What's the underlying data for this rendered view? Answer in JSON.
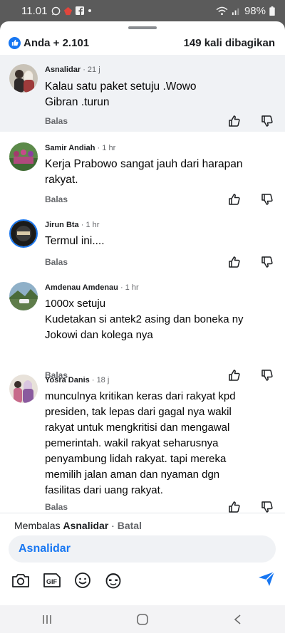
{
  "status_bar": {
    "time": "11.01",
    "battery": "98%"
  },
  "reactions": {
    "summary": "Anda + 2.101",
    "shares": "149 kali dibagikan"
  },
  "comments": [
    {
      "name": "Asnalidar",
      "time": "21 j",
      "text_lines": [
        "Kalau satu paket setuju .Wowo",
        "Gibran .turun"
      ],
      "reply_label": "Balas"
    },
    {
      "name": "Samir Andiah",
      "time": "1 hr",
      "text_lines": [
        "Kerja Prabowo sangat jauh dari harapan",
        "rakyat."
      ],
      "reply_label": "Balas"
    },
    {
      "name": "Jirun Bta",
      "time": "1 hr",
      "text_lines": [
        "Termul ini...."
      ],
      "reply_label": "Balas"
    },
    {
      "name": "Amdenau Amdenau",
      "time": "1 hr",
      "text_lines": [
        "1000x setuju",
        "Kudetakan si antek2 asing dan boneka ny",
        "Jokowi dan kolega nya"
      ],
      "reply_label": "Balas"
    },
    {
      "name": "Yosra Danis",
      "time": "18 j",
      "text_lines": [
        "munculnya kritikan keras dari rakyat kpd",
        "presiden, tak lepas dari gagal nya wakil",
        "rakyat untuk mengkritisi dan mengawal",
        "pemerintah. wakil rakyat seharusnya",
        "penyambung lidah rakyat. tapi mereka",
        "memilih jalan aman dan nyaman dgn",
        "fasilitas dari uang rakyat."
      ],
      "reply_label": "Balas"
    }
  ],
  "reply_bar": {
    "replying_prefix": "Membalas",
    "replying_to": "Asnalidar",
    "separator": " · ",
    "cancel_label": "Batal",
    "input_value": "Asnalidar",
    "gif_label": "GIF"
  },
  "colors": {
    "accent": "#1877f2",
    "muted": "#65676b",
    "highlight_bg": "#f0f2f5"
  },
  "icons": [
    "camera-icon",
    "gif-icon",
    "emoji-icon",
    "avatar-sticker-icon",
    "send-icon",
    "like-icon",
    "dislike-icon",
    "recent-apps-icon",
    "home-icon",
    "back-icon"
  ]
}
